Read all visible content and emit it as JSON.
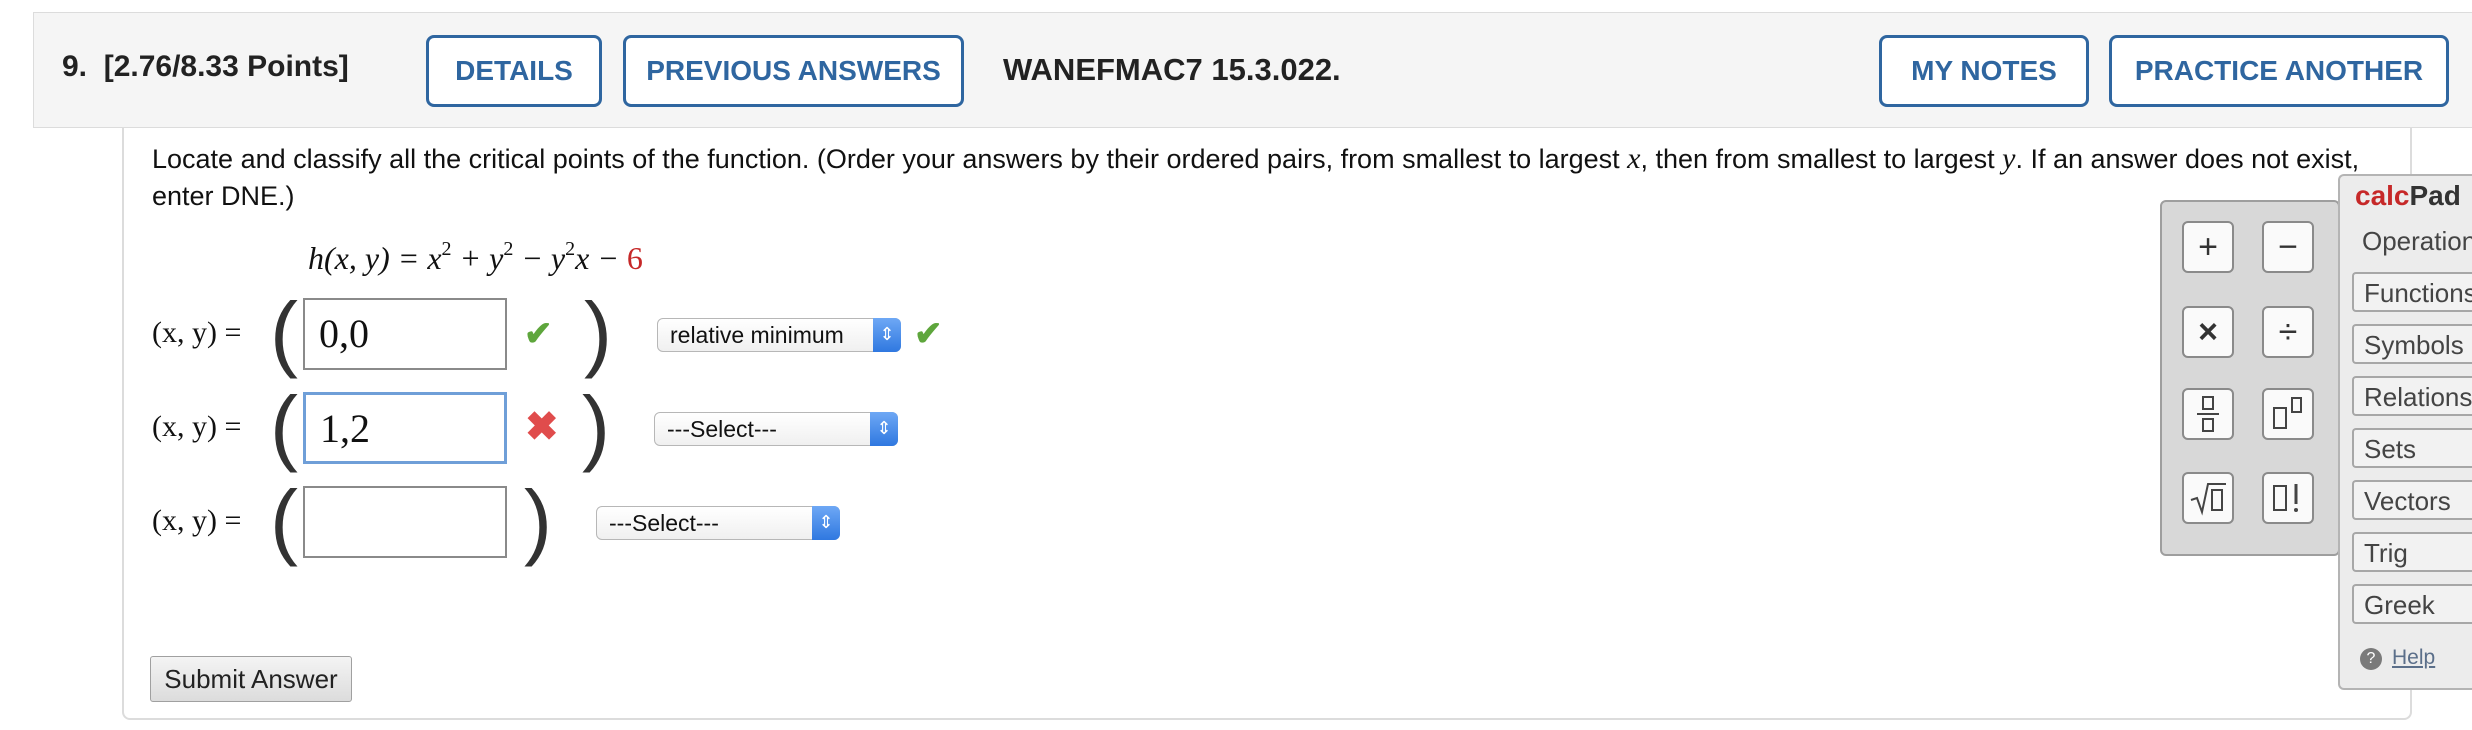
{
  "header": {
    "question_number": "9.",
    "points": "[2.76/8.33 Points]",
    "details_label": "DETAILS",
    "previous_answers_label": "PREVIOUS ANSWERS",
    "question_id": "WANEFMAC7 15.3.022.",
    "my_notes_label": "MY NOTES",
    "practice_another_label": "PRACTICE ANOTHER"
  },
  "question": {
    "prompt_part1": "Locate and classify all the critical points of the function. (Order your answers by their ordered pairs, from smallest to largest ",
    "var_x": "x",
    "prompt_part2": ", then from smallest to largest ",
    "var_y": "y",
    "prompt_part3": ". If an answer does not exist, enter DNE.)",
    "formula": {
      "lhs": "h(x, y) = x",
      "exp1": "2",
      "plus": " + y",
      "exp2": "2",
      "minus": " − y",
      "exp3": "2",
      "tail": "x − ",
      "constant": "6"
    }
  },
  "rows": [
    {
      "label": "(x, y)  =",
      "value": "0,0",
      "status": "correct",
      "classification": "relative minimum",
      "class_status": "correct"
    },
    {
      "label": "(x, y)  =",
      "value": "1,2",
      "status": "incorrect",
      "classification": "---Select---",
      "class_status": "none"
    },
    {
      "label": "(x, y)  =",
      "value": "",
      "status": "none",
      "classification": "---Select---",
      "class_status": "none"
    }
  ],
  "submit_label": "Submit Answer",
  "calcpad": {
    "title_a": "calc",
    "title_b": "Pad",
    "categories": [
      "Operations",
      "Functions",
      "Symbols",
      "Relations",
      "Sets",
      "Vectors",
      "Trig",
      "Greek"
    ],
    "help_label": "Help",
    "buttons": [
      "+",
      "−",
      "×",
      "÷",
      "fraction",
      "power",
      "sqrt",
      "factorial"
    ]
  },
  "colors": {
    "accent": "#2f66a0",
    "correct": "#5ea63c",
    "incorrect": "#e04c4c",
    "constant_red": "#c62828"
  }
}
